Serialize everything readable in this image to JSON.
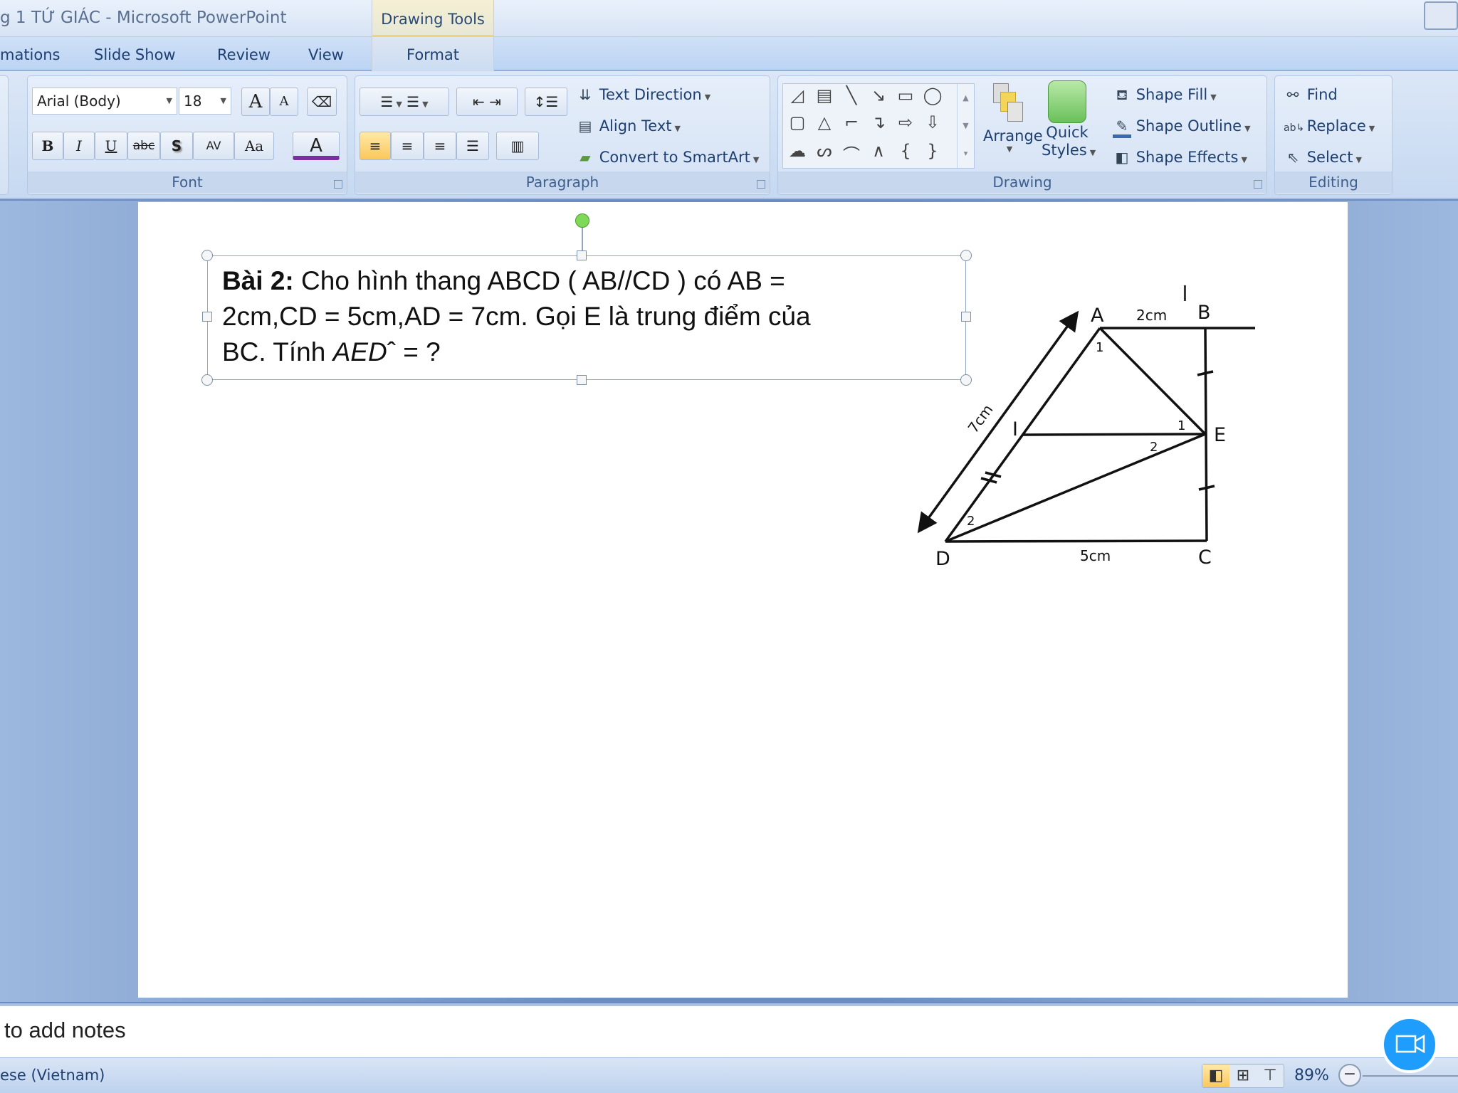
{
  "window": {
    "title": "g 1 TỨ GIÁC - Microsoft PowerPoint",
    "context_tab": "Drawing Tools"
  },
  "tabs": [
    {
      "label": "mations"
    },
    {
      "label": "Slide Show"
    },
    {
      "label": "Review"
    },
    {
      "label": "View"
    },
    {
      "label": "Format"
    }
  ],
  "ribbon": {
    "font": {
      "label": "Font",
      "font_name": "Arial (Body)",
      "font_size": "18",
      "grow": "A",
      "shrink": "A",
      "bold": "B",
      "italic": "I",
      "underline": "U",
      "strike": "abc",
      "shadow": "S",
      "spacing": "AV",
      "case": "Aa",
      "color": "A",
      "font_color": "#7a2fa0"
    },
    "paragraph": {
      "label": "Paragraph",
      "text_direction": "Text Direction",
      "align_text": "Align Text",
      "smartart": "Convert to SmartArt"
    },
    "drawing": {
      "label": "Drawing",
      "arrange": "Arrange",
      "quick_styles_1": "Quick",
      "quick_styles_2": "Styles",
      "shape_fill": "Shape Fill",
      "shape_outline": "Shape Outline",
      "shape_effects": "Shape Effects"
    },
    "editing": {
      "label": "Editing",
      "find": "Find",
      "replace": "Replace",
      "select": "Select"
    }
  },
  "slide": {
    "textbox": {
      "bold": "Bài 2:",
      "line1": " Cho hình thang ABCD ( AB//CD ) có AB =",
      "line2": "2cm,CD = 5cm,AD = 7cm. Gọi E là trung điểm của",
      "line3a": "BC. Tính ",
      "line3b": "AED",
      "line3c": "ˆ = ?"
    },
    "diagram": {
      "A": "A",
      "B": "B",
      "C": "C",
      "D": "D",
      "E": "E",
      "I": "I",
      "ab": "2cm",
      "cd": "5cm",
      "ad": "7cm",
      "a1": "1",
      "e1": "1",
      "e2": "2",
      "d2": "2"
    }
  },
  "notes": {
    "placeholder": "to add notes"
  },
  "status": {
    "language": "ese (Vietnam)",
    "zoom": "89%"
  },
  "colors": {
    "accent": "#1e9dfd",
    "selection": "#8fa7bf",
    "rotate_handle": "#7ed957"
  }
}
